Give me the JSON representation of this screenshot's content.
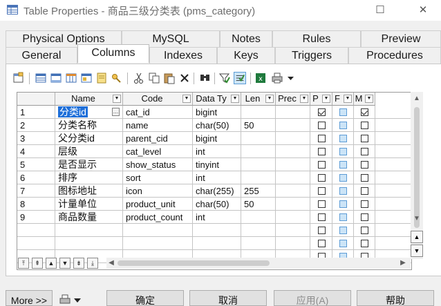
{
  "window": {
    "title": "Table Properties - 商品三级分类表 (pms_category)",
    "minimize_glyph": "☐",
    "close_glyph": "✕"
  },
  "tabs_back": [
    "Physical Options",
    "MySQL",
    "Notes",
    "Rules",
    "Preview"
  ],
  "tabs_front": [
    "General",
    "Columns",
    "Indexes",
    "Keys",
    "Triggers",
    "Procedures"
  ],
  "active_tab": "Columns",
  "toolbar_icons": [
    "properties-icon",
    "insert-row-icon",
    "add-row-icon",
    "add-columns-icon",
    "sequence-icon",
    "domain-icon",
    "cut-icon",
    "copy-icon",
    "paste-icon",
    "delete-icon",
    "find-icon",
    "filter-icon",
    "customize-columns-icon",
    "excel-export-icon",
    "print-icon",
    "dropdown-arrow-icon"
  ],
  "grid": {
    "columns": [
      "Name",
      "Code",
      "Data Ty",
      "Len",
      "Prec",
      "P",
      "F",
      "M"
    ],
    "rows": [
      {
        "num": "1",
        "name": "分类id",
        "code": "cat_id",
        "type": "bigint",
        "len": "",
        "prec": "",
        "p": true,
        "f": false,
        "m": true
      },
      {
        "num": "2",
        "name": "分类名称",
        "code": "name",
        "type": "char(50)",
        "len": "50",
        "prec": "",
        "p": false,
        "f": false,
        "m": false
      },
      {
        "num": "3",
        "name": "父分类id",
        "code": "parent_cid",
        "type": "bigint",
        "len": "",
        "prec": "",
        "p": false,
        "f": false,
        "m": false
      },
      {
        "num": "4",
        "name": "层级",
        "code": "cat_level",
        "type": "int",
        "len": "",
        "prec": "",
        "p": false,
        "f": false,
        "m": false
      },
      {
        "num": "5",
        "name": "是否显示",
        "code": "show_status",
        "type": "tinyint",
        "len": "",
        "prec": "",
        "p": false,
        "f": false,
        "m": false
      },
      {
        "num": "6",
        "name": "排序",
        "code": "sort",
        "type": "int",
        "len": "",
        "prec": "",
        "p": false,
        "f": false,
        "m": false
      },
      {
        "num": "7",
        "name": "图标地址",
        "code": "icon",
        "type": "char(255)",
        "len": "255",
        "prec": "",
        "p": false,
        "f": false,
        "m": false
      },
      {
        "num": "8",
        "name": "计量单位",
        "code": "product_unit",
        "type": "char(50)",
        "len": "50",
        "prec": "",
        "p": false,
        "f": false,
        "m": false
      },
      {
        "num": "9",
        "name": "商品数量",
        "code": "product_count",
        "type": "int",
        "len": "",
        "prec": "",
        "p": false,
        "f": false,
        "m": false
      }
    ],
    "empty_rows": 3,
    "selected_row": 0
  },
  "nav_buttons": [
    "top",
    "page-up",
    "up",
    "down",
    "page-down",
    "bottom"
  ],
  "buttons": {
    "more": "More >>",
    "ok": "确定",
    "cancel": "取消",
    "apply": "应用(A)",
    "help": "帮助"
  },
  "colors": {
    "selection": "#1e6fd9",
    "foreign_key_checkbox": "#cce4f7"
  }
}
